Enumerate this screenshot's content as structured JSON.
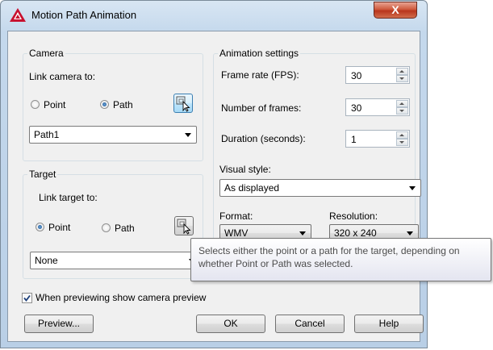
{
  "window": {
    "title": "Motion Path Animation",
    "close_label": "X",
    "app_icon": "autocad-logo-icon"
  },
  "camera": {
    "group_label": "Camera",
    "link_label": "Link camera to:",
    "point_label": "Point",
    "path_label": "Path",
    "selected": "Path",
    "pick_icon": "pick-object-icon",
    "dropdown_value": "Path1"
  },
  "target": {
    "group_label": "Target",
    "link_label": "Link target to:",
    "point_label": "Point",
    "path_label": "Path",
    "selected": "Point",
    "pick_icon": "pick-object-icon",
    "dropdown_value": "None"
  },
  "animation": {
    "group_label": "Animation settings",
    "frame_rate_label": "Frame rate (FPS):",
    "frame_rate_value": "30",
    "frames_label": "Number of frames:",
    "frames_value": "30",
    "duration_label": "Duration (seconds):",
    "duration_value": "1",
    "visual_style_label": "Visual style:",
    "visual_style_value": "As displayed",
    "format_label": "Format:",
    "format_value": "WMV",
    "resolution_label": "Resolution:",
    "resolution_value": "320 x 240"
  },
  "preview_checkbox": {
    "label": "When previewing show camera preview",
    "checked": true
  },
  "buttons": {
    "preview": "Preview...",
    "ok": "OK",
    "cancel": "Cancel",
    "help": "Help"
  },
  "tooltip": {
    "text": "Selects either the point or a path for the target, depending on whether Point or Path was selected."
  }
}
